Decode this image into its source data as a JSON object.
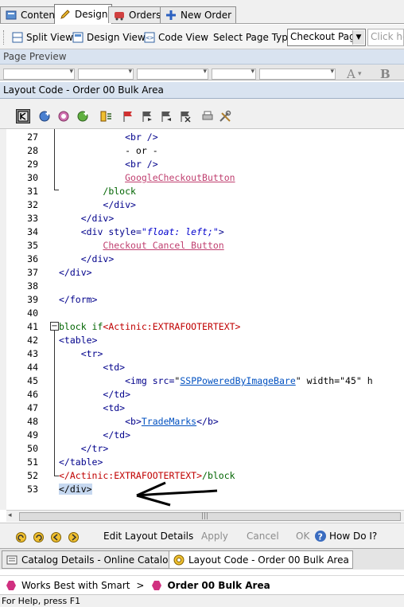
{
  "top_tabs": [
    "Content",
    "Design",
    "Orders",
    "New Order"
  ],
  "toolbar": {
    "split_view": "Split View",
    "design_view": "Design View",
    "code_view": "Code View",
    "select_page_type_label": "Select Page Type",
    "page_type_value": "Checkout Page",
    "help_placeholder": "Click he"
  },
  "preview": {
    "title": "Page Preview"
  },
  "layout_code": {
    "title": "Layout Code  - Order 00 Bulk Area"
  },
  "code_lines": [
    {
      "n": "27",
      "parts": [
        [
          "",
          "            "
        ],
        [
          "tag",
          "<br />"
        ]
      ]
    },
    {
      "n": "28",
      "parts": [
        [
          "",
          "            - or -"
        ]
      ]
    },
    {
      "n": "29",
      "parts": [
        [
          "",
          "            "
        ],
        [
          "tag",
          "<br />"
        ]
      ]
    },
    {
      "n": "30",
      "parts": [
        [
          "",
          "            "
        ],
        [
          "link-pink",
          "GoogleCheckoutButton"
        ]
      ]
    },
    {
      "n": "31",
      "parts": [
        [
          "",
          "        "
        ],
        [
          "green",
          "/block"
        ]
      ]
    },
    {
      "n": "32",
      "parts": [
        [
          "",
          "        "
        ],
        [
          "tag",
          "</div>"
        ]
      ]
    },
    {
      "n": "33",
      "parts": [
        [
          "",
          "    "
        ],
        [
          "tag",
          "</div>"
        ]
      ]
    },
    {
      "n": "34",
      "parts": [
        [
          "",
          "    "
        ],
        [
          "tag",
          "<div style="
        ],
        [
          "italic-blue",
          "\"float: left;\""
        ],
        [
          "tag",
          ">"
        ]
      ]
    },
    {
      "n": "35",
      "parts": [
        [
          "",
          "        "
        ],
        [
          "link-pink",
          "Checkout Cancel Button"
        ]
      ]
    },
    {
      "n": "36",
      "parts": [
        [
          "",
          "    "
        ],
        [
          "tag",
          "</div>"
        ]
      ]
    },
    {
      "n": "37",
      "parts": [
        [
          "tag",
          "</div>"
        ]
      ]
    },
    {
      "n": "38",
      "parts": [
        [
          "",
          ""
        ]
      ]
    },
    {
      "n": "39",
      "parts": [
        [
          "tag",
          "</form>"
        ]
      ]
    },
    {
      "n": "40",
      "parts": [
        [
          "",
          ""
        ]
      ]
    },
    {
      "n": "41",
      "parts": [
        [
          "green",
          "block if"
        ],
        [
          "red",
          "<Actinic:EXTRAFOOTERTEXT>"
        ]
      ]
    },
    {
      "n": "42",
      "parts": [
        [
          "tag",
          "<table>"
        ]
      ]
    },
    {
      "n": "43",
      "parts": [
        [
          "",
          "    "
        ],
        [
          "tag",
          "<tr>"
        ]
      ]
    },
    {
      "n": "44",
      "parts": [
        [
          "",
          "        "
        ],
        [
          "tag",
          "<td>"
        ]
      ]
    },
    {
      "n": "45",
      "parts": [
        [
          "",
          "            "
        ],
        [
          "tag",
          "<img src="
        ],
        [
          "",
          "\""
        ],
        [
          "link-blue",
          "SSPPoweredByImageBare"
        ],
        [
          "",
          "\" width=\"45\" h"
        ]
      ]
    },
    {
      "n": "46",
      "parts": [
        [
          "",
          "        "
        ],
        [
          "tag",
          "</td>"
        ]
      ]
    },
    {
      "n": "47",
      "parts": [
        [
          "",
          "        "
        ],
        [
          "tag",
          "<td>"
        ]
      ]
    },
    {
      "n": "48",
      "parts": [
        [
          "",
          "            "
        ],
        [
          "tag",
          "<b>"
        ],
        [
          "link-blue",
          "TradeMarks"
        ],
        [
          "tag",
          "</b>"
        ]
      ]
    },
    {
      "n": "49",
      "parts": [
        [
          "",
          "        "
        ],
        [
          "tag",
          "</td>"
        ]
      ]
    },
    {
      "n": "50",
      "parts": [
        [
          "",
          "    "
        ],
        [
          "tag",
          "</tr>"
        ]
      ]
    },
    {
      "n": "51",
      "parts": [
        [
          "tag",
          "</table>"
        ]
      ]
    },
    {
      "n": "52",
      "parts": [
        [
          "red",
          "</Actinic:EXTRAFOOTERTEXT>"
        ],
        [
          "green",
          "/block"
        ]
      ]
    },
    {
      "n": "53",
      "parts": [
        [
          "sel",
          "</div>"
        ]
      ]
    }
  ],
  "action_bar": {
    "edit_layout_details": "Edit Layout Details",
    "apply": "Apply",
    "cancel": "Cancel",
    "ok": "OK",
    "how_do_i": "How Do I?"
  },
  "bottom_tabs": [
    "Catalog Details - Online Catalogue",
    "Layout Code  - Order 00 Bulk Area"
  ],
  "breadcrumb": {
    "item1": "Works Best with Smart",
    "separator": ">",
    "item2": "Order 00 Bulk Area"
  },
  "status": "For Help, press F1",
  "colors": {
    "panel_header": "#d9e3f0",
    "tag_color": "#00008b",
    "block_green": "#006400",
    "actinic_red": "#c00000"
  }
}
